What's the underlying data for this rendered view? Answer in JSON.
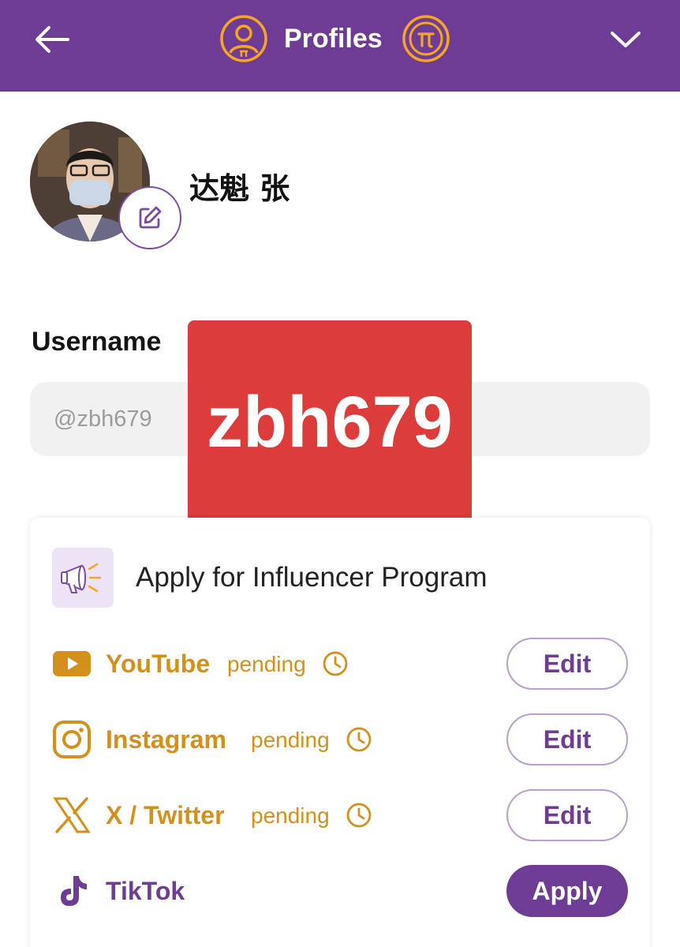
{
  "header": {
    "title": "Profiles",
    "back_icon": "arrow-left-icon",
    "menu_icon": "chevron-down-icon",
    "colors": {
      "bar": "#6e3c95",
      "accent": "#f5a623"
    }
  },
  "profile": {
    "display_name": "达魁 张",
    "username_label": "Username",
    "username_value": "@zbh679",
    "redaction_text": "zbh679"
  },
  "influencer": {
    "title": "Apply for Influencer Program",
    "icon": "megaphone-icon",
    "platforms": [
      {
        "name": "YouTube",
        "icon": "youtube-icon",
        "status": "pending",
        "action": "Edit",
        "color": "#d4901c"
      },
      {
        "name": "Instagram",
        "icon": "instagram-icon",
        "status": "pending",
        "action": "Edit",
        "color": "#d4901c"
      },
      {
        "name": "X / Twitter",
        "icon": "x-twitter-icon",
        "status": "pending",
        "action": "Edit",
        "color": "#d4901c"
      },
      {
        "name": "TikTok",
        "icon": "tiktok-icon",
        "status": "",
        "action": "Apply",
        "color": "#6e3c95"
      }
    ]
  }
}
